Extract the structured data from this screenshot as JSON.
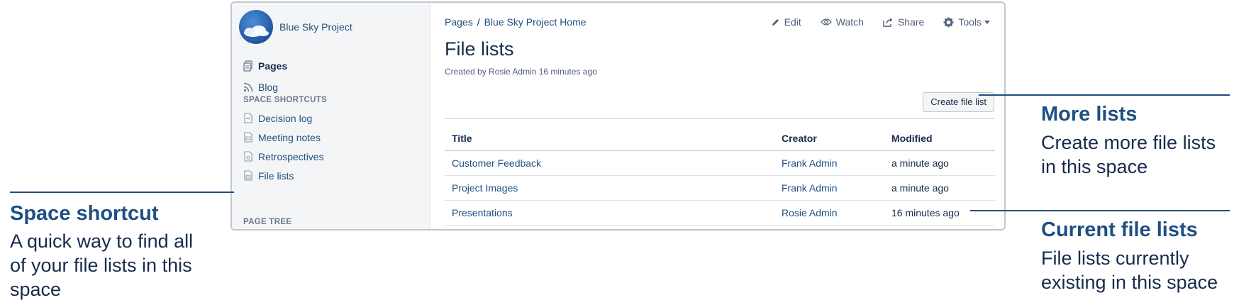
{
  "space": {
    "name": "Blue Sky Project"
  },
  "sidebar": {
    "primary": [
      {
        "label": "Pages",
        "icon": "pages-icon",
        "active": true
      },
      {
        "label": "Blog",
        "icon": "rss-icon"
      }
    ],
    "shortcuts_title": "SPACE SHORTCUTS",
    "shortcuts": [
      {
        "label": "Decision log",
        "icon": "decision-log-icon"
      },
      {
        "label": "Meeting notes",
        "icon": "meeting-notes-icon"
      },
      {
        "label": "Retrospectives",
        "icon": "retrospectives-icon"
      },
      {
        "label": "File lists",
        "icon": "file-lists-icon"
      }
    ],
    "page_tree_title": "PAGE TREE"
  },
  "breadcrumb": {
    "root": "Pages",
    "separator": "/",
    "current": "Blue Sky Project Home"
  },
  "actions": {
    "edit": "Edit",
    "watch": "Watch",
    "share": "Share",
    "tools": "Tools"
  },
  "page": {
    "title": "File lists",
    "byline": "Created by Rosie Admin 16 minutes ago",
    "create_button": "Create file list"
  },
  "table": {
    "headers": [
      "Title",
      "Creator",
      "Modified"
    ],
    "rows": [
      {
        "title": "Customer Feedback",
        "creator": "Frank Admin",
        "modified": "a minute ago"
      },
      {
        "title": "Project Images",
        "creator": "Frank Admin",
        "modified": "a minute ago"
      },
      {
        "title": "Presentations",
        "creator": "Rosie Admin",
        "modified": "16 minutes ago"
      }
    ]
  },
  "annotations": {
    "space_shortcut": {
      "title": "Space shortcut",
      "body": [
        "A quick way to find all",
        "of your file lists in this",
        "space"
      ]
    },
    "more_lists": {
      "title": "More lists",
      "body": [
        "Create more file lists",
        "in this space"
      ]
    },
    "current_lists": {
      "title": "Current file lists",
      "body": [
        "File lists currently",
        "existing in this space"
      ]
    }
  },
  "colors": {
    "link": "#205081",
    "annotation": "#1f4f82",
    "sidebar_bg": "#f4f5f7"
  }
}
